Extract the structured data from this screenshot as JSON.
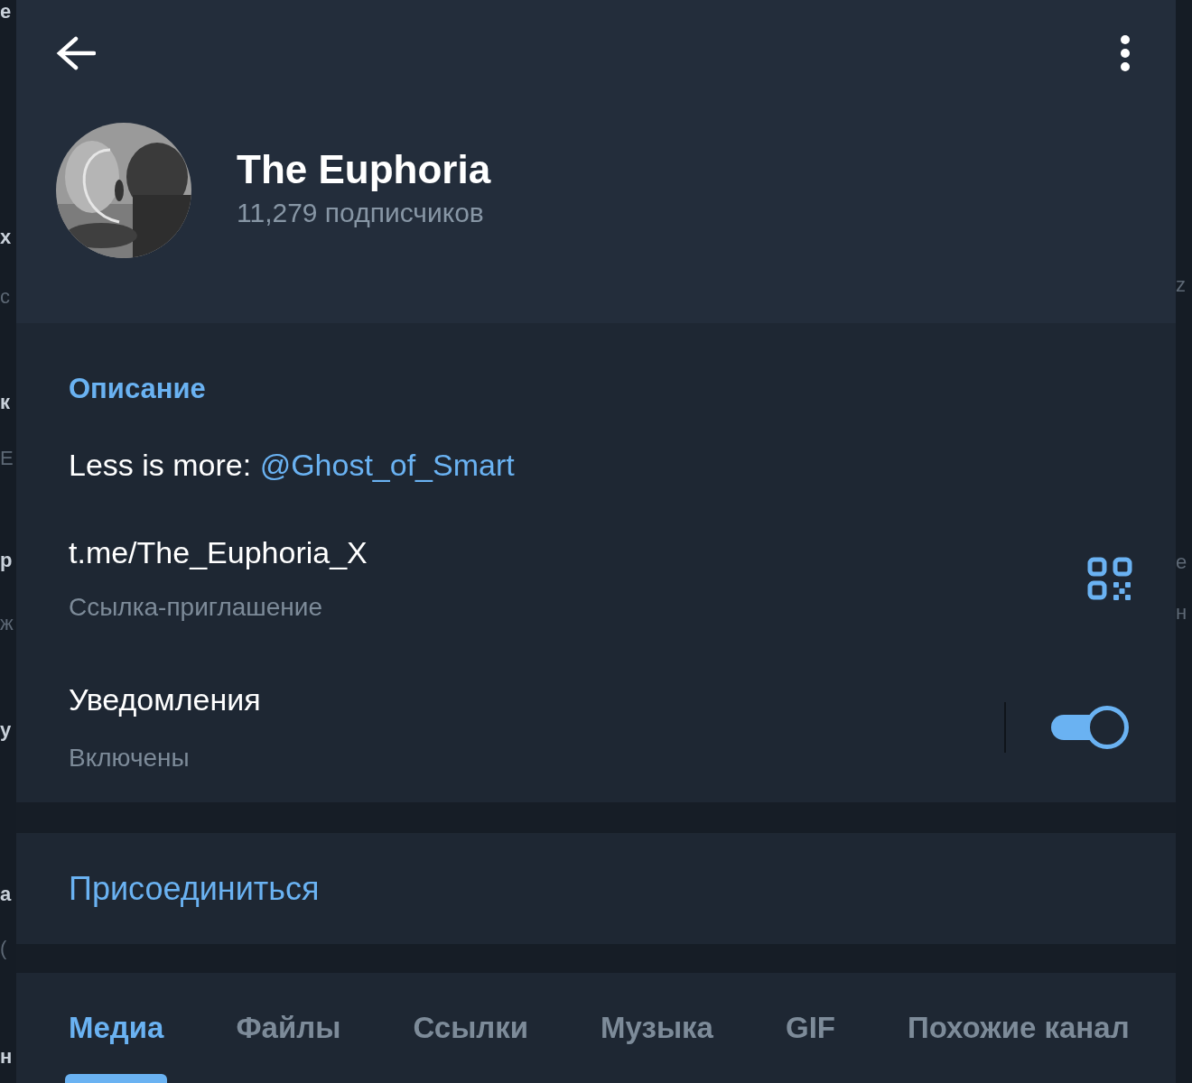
{
  "channel": {
    "title": "The Euphoria",
    "subtitle": "11,279 подписчиков"
  },
  "info": {
    "heading": "Описание",
    "description": "Less is more: ",
    "mention": "@Ghost_of_Smart",
    "link": "t.me/The_Euphoria_X",
    "link_caption": "Ссылка-приглашение"
  },
  "notifications": {
    "label": "Уведомления",
    "status": "Включены",
    "on": true
  },
  "join": {
    "label": "Присоединиться"
  },
  "tabs": [
    {
      "label": "Медиа",
      "selected": true
    },
    {
      "label": "Файлы",
      "selected": false
    },
    {
      "label": "Ссылки",
      "selected": false
    },
    {
      "label": "Музыка",
      "selected": false
    },
    {
      "label": "GIF",
      "selected": false
    },
    {
      "label": "Похожие канал",
      "selected": false
    }
  ],
  "background_left": [
    {
      "text": "е",
      "dim": false
    },
    {
      "text": "х",
      "dim": false
    },
    {
      "text": "с",
      "dim": true
    },
    {
      "text": "к",
      "dim": false
    },
    {
      "text": "Е",
      "dim": true
    },
    {
      "text": "р",
      "dim": false
    },
    {
      "text": "ж",
      "dim": true
    },
    {
      "text": "у",
      "dim": false
    },
    {
      "text": "а",
      "dim": false
    },
    {
      "text": "(",
      "dim": true
    },
    {
      "text": "н",
      "dim": false
    }
  ],
  "background_right": [
    {
      "text": "z",
      "dim": true
    },
    {
      "text": "е",
      "dim": true
    },
    {
      "text": "н",
      "dim": true
    }
  ]
}
